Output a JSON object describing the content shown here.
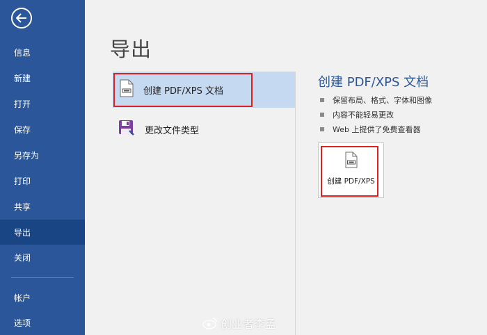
{
  "sidebar": {
    "items": [
      {
        "label": "信息"
      },
      {
        "label": "新建"
      },
      {
        "label": "打开"
      },
      {
        "label": "保存"
      },
      {
        "label": "另存为"
      },
      {
        "label": "打印"
      },
      {
        "label": "共享"
      },
      {
        "label": "导出",
        "active": true
      },
      {
        "label": "关闭"
      },
      {
        "label": "帐户"
      },
      {
        "label": "选项"
      }
    ]
  },
  "page": {
    "title": "导出"
  },
  "export_options": [
    {
      "label": "创建 PDF/XPS 文档",
      "icon": "pdf-document-icon",
      "selected": true
    },
    {
      "label": "更改文件类型",
      "icon": "save-disk-icon",
      "selected": false
    }
  ],
  "detail": {
    "title": "创建 PDF/XPS 文档",
    "bullets": [
      "保留布局、格式、字体和图像",
      "内容不能轻易更改",
      "Web 上提供了免费查看器"
    ],
    "button_label": "创建 PDF/XPS"
  },
  "watermark": {
    "text": "创业者李孟"
  },
  "colors": {
    "sidebar": "#2b579a",
    "sidebar_active": "#194585",
    "selected_option": "#c5d9f1",
    "highlight_box": "#e02020",
    "accent_text": "#2b579a"
  }
}
